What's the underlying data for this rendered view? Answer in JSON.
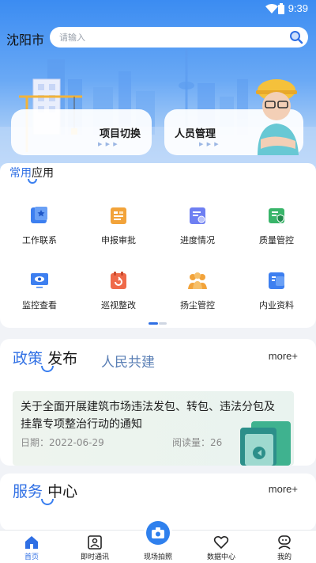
{
  "status_bar": {
    "time": "9:39"
  },
  "header": {
    "city": "沈阳市",
    "search": {
      "placeholder": "请输入",
      "value": ""
    }
  },
  "hero_cards": [
    {
      "label": "项目切换",
      "arrows": "▶ ▶ ▶"
    },
    {
      "label": "人员管理",
      "arrows": "▶ ▶ ▶"
    }
  ],
  "common_apps": {
    "title_a": "常用",
    "title_b": "应用",
    "items": [
      {
        "label": "工作联系",
        "icon": "work-contact-icon",
        "color": "#3d7ff0"
      },
      {
        "label": "申报审批",
        "icon": "approval-icon",
        "color": "#f2a33a"
      },
      {
        "label": "进度情况",
        "icon": "progress-icon",
        "color": "#6e7ff2"
      },
      {
        "label": "质量管控",
        "icon": "quality-icon",
        "color": "#39b56a"
      },
      {
        "label": "监控查看",
        "icon": "monitor-icon",
        "color": "#3d7ff0"
      },
      {
        "label": "巡视整改",
        "icon": "patrol-icon",
        "color": "#ef6a4a"
      },
      {
        "label": "扬尘管控",
        "icon": "dust-control-icon",
        "color": "#f2a33a"
      },
      {
        "label": "内业资料",
        "icon": "documents-icon",
        "color": "#3d7ff0"
      }
    ]
  },
  "policy": {
    "tab_active_a": "政策",
    "tab_active_b": "发布",
    "tab_other": "人民共建",
    "more": "more+",
    "news": {
      "title": "关于全面开展建筑市场违法发包、转包、违法分包及挂靠专项整治行动的通知",
      "date": "日期：2022-06-29",
      "reads": "阅读量：26"
    }
  },
  "service": {
    "title_a": "服务",
    "title_b": "中心",
    "more": "more+"
  },
  "nav": [
    {
      "label": "首页",
      "icon": "home-icon",
      "active": true
    },
    {
      "label": "即时通讯",
      "icon": "contact-card-icon",
      "active": false
    },
    {
      "label": "现场拍照",
      "icon": "camera-icon",
      "active": false
    },
    {
      "label": "数据中心",
      "icon": "heart-icon",
      "active": false
    },
    {
      "label": "我的",
      "icon": "profile-icon",
      "active": false
    }
  ],
  "colors": {
    "accent": "#2f6fe4",
    "hero_top": "#3b8cf2",
    "background": "#f1f3f7"
  }
}
